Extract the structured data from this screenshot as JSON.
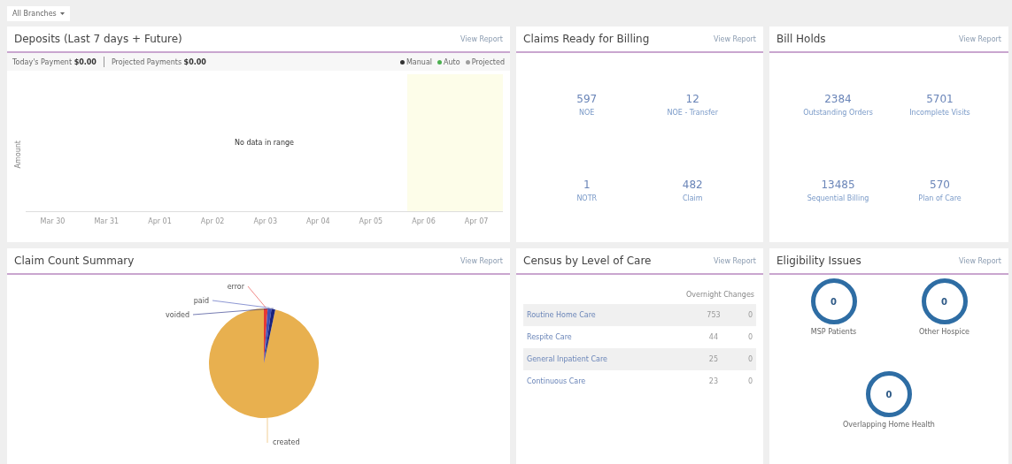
{
  "branch_filter": {
    "label": "All Branches"
  },
  "deposits": {
    "title": "Deposits (Last 7 days + Future)",
    "link": "View Report",
    "summary": [
      {
        "label": "Today's Payment",
        "value": "$0.00"
      },
      {
        "label": "Projected Payments",
        "value": "$0.00"
      }
    ],
    "legend": [
      {
        "label": "Manual",
        "color": "#333333"
      },
      {
        "label": "Auto",
        "color": "#4caf50"
      },
      {
        "label": "Projected",
        "color": "#9e9e9e"
      }
    ],
    "y_axis_label": "Amount",
    "empty_message": "No data in range",
    "x_labels": [
      "Mar 30",
      "Mar 31",
      "Apr 01",
      "Apr 02",
      "Apr 03",
      "Apr 04",
      "Apr 05",
      "Apr 06",
      "Apr 07"
    ]
  },
  "claims_ready": {
    "title": "Claims Ready for Billing",
    "link": "View Report",
    "stats": [
      {
        "value": "597",
        "label": "NOE"
      },
      {
        "value": "12",
        "label": "NOE - Transfer"
      },
      {
        "value": "1",
        "label": "NOTR"
      },
      {
        "value": "482",
        "label": "Claim"
      }
    ]
  },
  "bill_holds": {
    "title": "Bill Holds",
    "link": "View Report",
    "stats": [
      {
        "value": "2384",
        "label": "Outstanding Orders"
      },
      {
        "value": "5701",
        "label": "Incomplete Visits"
      },
      {
        "value": "13485",
        "label": "Sequential Billing"
      },
      {
        "value": "570",
        "label": "Plan of Care"
      }
    ]
  },
  "claim_count": {
    "title": "Claim Count Summary",
    "link": "View Report",
    "slices": [
      {
        "label": "error",
        "color": "#e53935"
      },
      {
        "label": "paid",
        "color": "#3f51b5"
      },
      {
        "label": "voided",
        "color": "#1a237e"
      },
      {
        "label": "created",
        "color": "#e8b04f"
      }
    ]
  },
  "census": {
    "title": "Census by Level of Care",
    "link": "View Report",
    "column_header": "Overnight Changes",
    "rows": [
      {
        "name": "Routine Home Care",
        "count": "753",
        "change": "0"
      },
      {
        "name": "Respite Care",
        "count": "44",
        "change": "0"
      },
      {
        "name": "General Inpatient Care",
        "count": "25",
        "change": "0"
      },
      {
        "name": "Continuous Care",
        "count": "23",
        "change": "0"
      }
    ]
  },
  "eligibility": {
    "title": "Eligibility Issues",
    "link": "View Report",
    "items": [
      {
        "value": "0",
        "label": "MSP Patients"
      },
      {
        "value": "0",
        "label": "Other Hospice"
      },
      {
        "value": "0",
        "label": "Overlapping Home Health"
      }
    ]
  }
}
